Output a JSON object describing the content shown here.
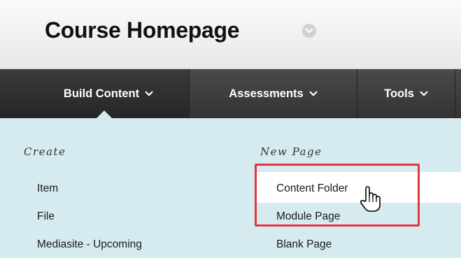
{
  "page": {
    "title": "Course Homepage"
  },
  "toolbar": {
    "tabs": [
      {
        "label": "Build Content",
        "active": true
      },
      {
        "label": "Assessments",
        "active": false
      },
      {
        "label": "Tools",
        "active": false
      }
    ]
  },
  "menu": {
    "create": {
      "heading": "Create",
      "items": [
        "Item",
        "File",
        "Mediasite - Upcoming"
      ]
    },
    "new_page": {
      "heading": "New Page",
      "items": [
        "Content Folder",
        "Module Page",
        "Blank Page"
      ]
    }
  },
  "colors": {
    "toolbar": "#333333",
    "panel": "#d6ebf0",
    "highlight": "#e2373c"
  },
  "icons": [
    "chevron-down-icon",
    "hand-cursor-icon"
  ]
}
